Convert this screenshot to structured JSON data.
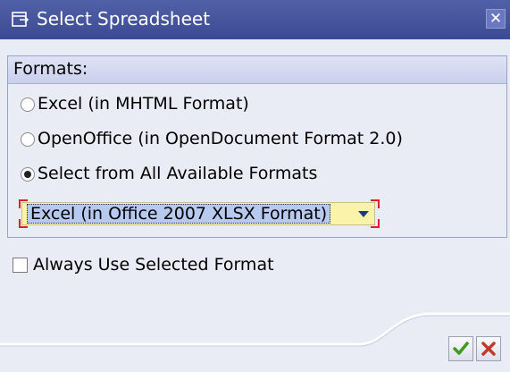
{
  "window": {
    "title": "Select Spreadsheet",
    "close_glyph": "✕",
    "title_icon": "dialog-icon"
  },
  "formats_group": {
    "title": "Formats:",
    "options": [
      {
        "label": "Excel (in MHTML Format)",
        "selected": false
      },
      {
        "label": "OpenOffice (in OpenDocument Format 2.0)",
        "selected": false
      },
      {
        "label": "Select from All Available Formats",
        "selected": true
      }
    ],
    "format_dropdown": {
      "selected_value": "Excel (in Office 2007 XLSX Format)"
    }
  },
  "always_use_checkbox": {
    "label": "Always Use Selected Format",
    "checked": false
  },
  "buttons": {
    "ok_icon": "checkmark-icon",
    "cancel_icon": "x-icon"
  },
  "colors": {
    "title_bar": "#3f4e96",
    "dialog_bg": "#e9ebf5",
    "dropdown_bg": "#fbf3a8",
    "required_marker": "#d8222a",
    "ok_green": "#3f9a1e",
    "cancel_red": "#c8362a"
  }
}
